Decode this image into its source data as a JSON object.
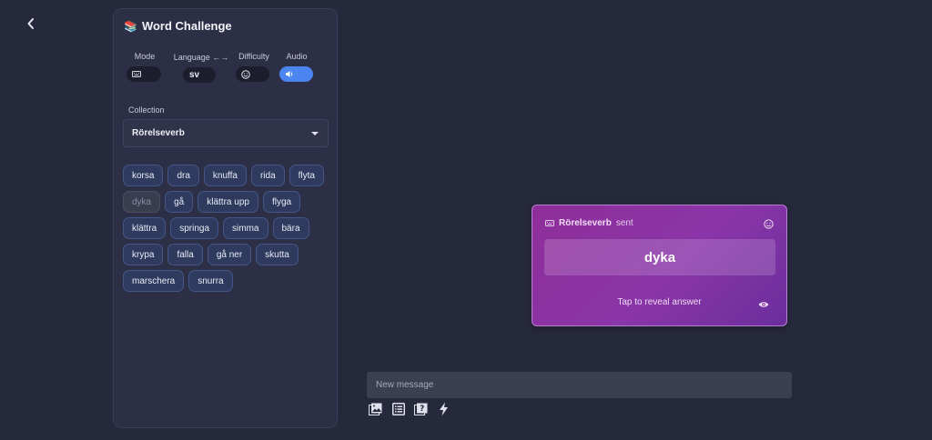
{
  "panel": {
    "title": "Word Challenge",
    "title_icon": "books-icon",
    "controls": {
      "mode": {
        "label": "Mode",
        "icon": "keyboard-icon"
      },
      "language": {
        "label": "Language ←→",
        "value": "sv"
      },
      "difficulty": {
        "label": "Difficulty",
        "icon": "smiley-icon"
      },
      "audio": {
        "label": "Audio",
        "icon": "speaker-icon",
        "enabled": true
      }
    },
    "collection": {
      "label": "Collection",
      "selected": "Rörelseverb"
    },
    "words": [
      "korsa",
      "dra",
      "knuffa",
      "rida",
      "flyta",
      "dyka",
      "gå",
      "klättra upp",
      "flyga",
      "klättra",
      "springa",
      "simma",
      "bära",
      "krypa",
      "falla",
      "gå ner",
      "skutta",
      "marschera",
      "snurra"
    ],
    "used_words": [
      "dyka"
    ]
  },
  "card": {
    "sender": "Rörelseverb",
    "sent_text": "sent",
    "word": "dyka",
    "reveal_text": "Tap to reveal answer"
  },
  "composer": {
    "placeholder": "New message"
  },
  "colors": {
    "accent": "#4b86f0",
    "card_gradient_start": "#8e2e99",
    "card_gradient_end": "#6b2e9c",
    "background": "#26283b"
  }
}
